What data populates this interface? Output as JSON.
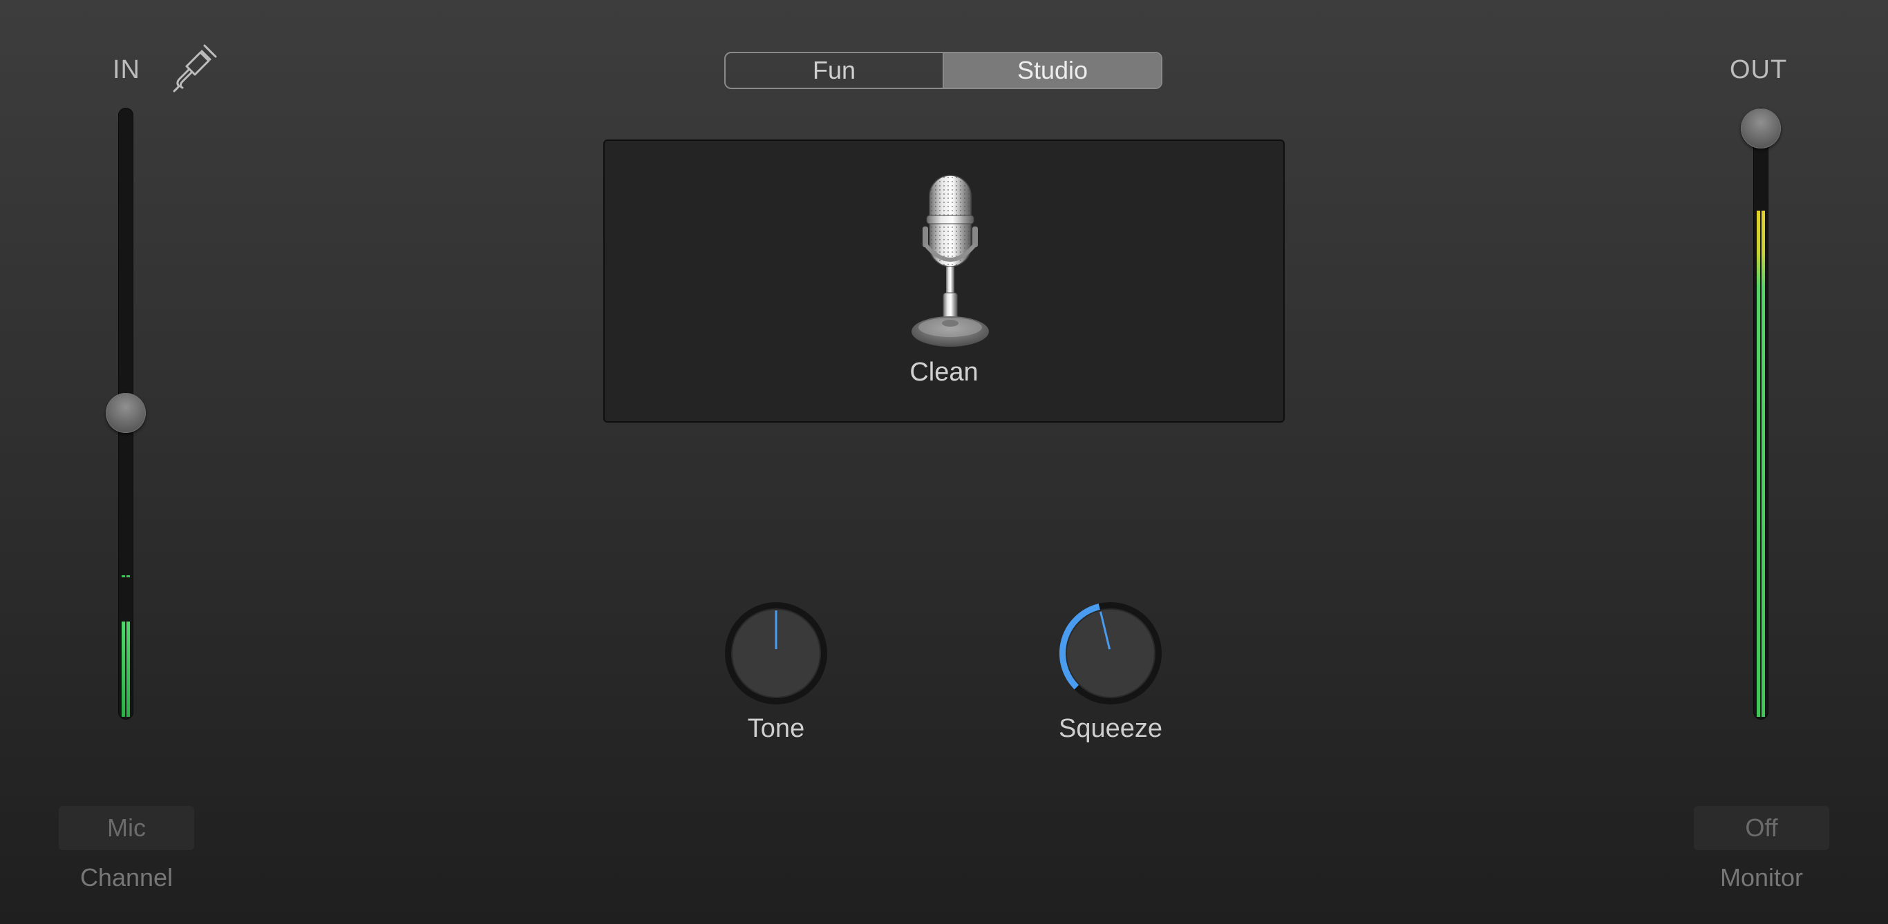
{
  "input": {
    "label": "IN",
    "level_fraction": 0.5,
    "meter_level_fraction": 0.15,
    "peak_level_fraction": 0.23
  },
  "output": {
    "label": "OUT",
    "level_fraction": 1.0,
    "meter_level_fraction": 0.83
  },
  "mode_selector": {
    "options": [
      "Fun",
      "Studio"
    ],
    "selected": "Studio"
  },
  "preset": {
    "name": "Clean",
    "icon": "studio-microphone-icon"
  },
  "knobs": {
    "tone": {
      "label": "Tone",
      "value_fraction": 0.5
    },
    "squeeze": {
      "label": "Squeeze",
      "value_fraction": 0.45
    }
  },
  "channel": {
    "button_label": "Mic",
    "caption": "Channel"
  },
  "monitor": {
    "button_label": "Off",
    "caption": "Monitor"
  },
  "colors": {
    "accent_blue": "#4a9cf0",
    "meter_green": "#42c659",
    "meter_yellow": "#e2d12a",
    "background": "#333333"
  }
}
